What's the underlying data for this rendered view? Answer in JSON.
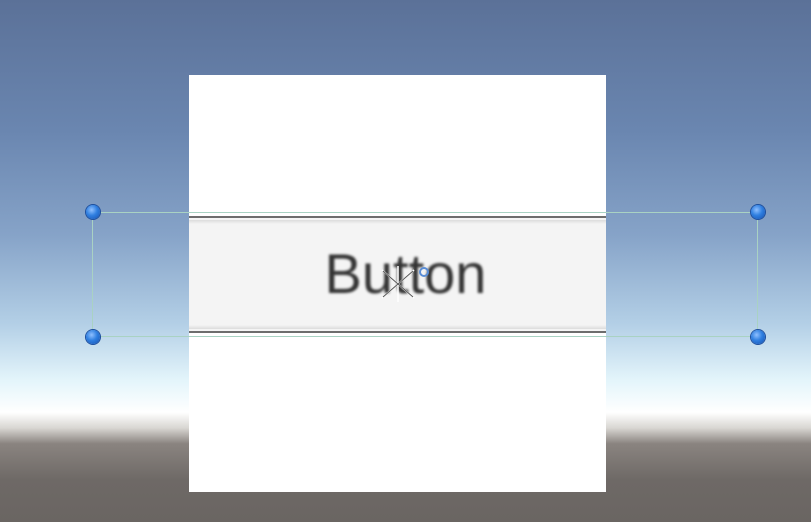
{
  "scene": {
    "background": "skybox-gradient"
  },
  "ui_button": {
    "label": "Button"
  },
  "gizmos": {
    "handle_color": "#2f7fe0",
    "outline_color": "#a9d2c3",
    "anchor_icon": "anchor-flower-icon",
    "pivot_icon": "pivot-circle-icon"
  }
}
